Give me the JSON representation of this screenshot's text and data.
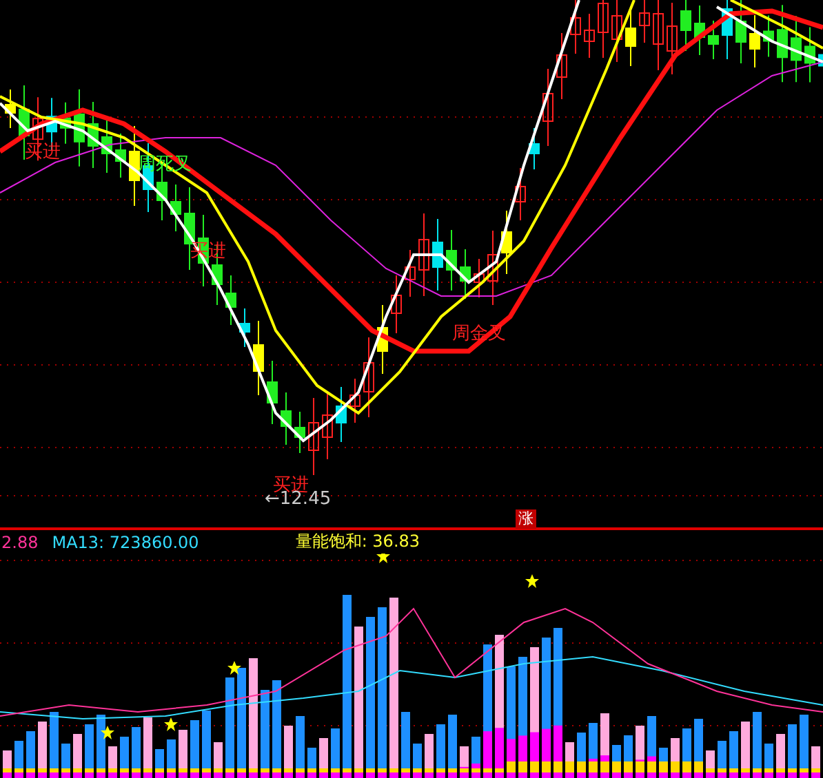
{
  "price_chart": {
    "annotations": [
      {
        "text": "买进",
        "kind": "buy"
      },
      {
        "text": "周死叉",
        "kind": "death-cross"
      },
      {
        "text": "买进",
        "kind": "buy"
      },
      {
        "text": "买进",
        "kind": "buy"
      },
      {
        "text": "←12.45",
        "kind": "low-price"
      },
      {
        "text": "周金叉",
        "kind": "golden-cross"
      },
      {
        "text": "涨",
        "kind": "rise-badge"
      }
    ]
  },
  "volume_legend": [
    {
      "text": "2.88",
      "color": "#ff3399"
    },
    {
      "text": "MA13: 723860.00",
      "color": "#33ddff"
    },
    {
      "text": "量能饱和: 36.83",
      "color": "#ffff33"
    }
  ]
}
